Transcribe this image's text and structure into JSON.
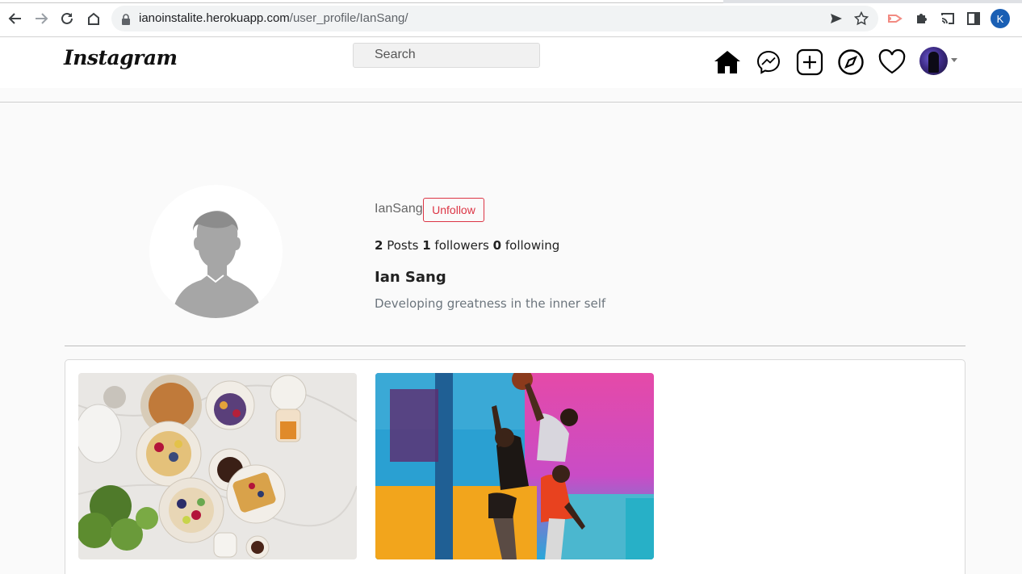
{
  "browser": {
    "url_host": "ianoinstalite.herokuapp.com",
    "url_path": "/user_profile/IanSang/",
    "profile_initial": "K"
  },
  "header": {
    "logo": "Instagram",
    "search_placeholder": "Search",
    "icons": [
      "home-icon",
      "messenger-icon",
      "add-post-icon",
      "explore-icon",
      "heart-icon"
    ]
  },
  "profile": {
    "username": "IanSang",
    "action_label": "Unfollow",
    "posts_count": "2",
    "posts_label": "Posts",
    "followers_count": "1",
    "followers_label": "followers",
    "following_count": "0",
    "following_label": "following",
    "full_name": "Ian Sang",
    "bio": "Developing greatness in the inner self"
  },
  "posts": [
    {
      "subject": "breakfast-flatlay"
    },
    {
      "subject": "basketball-players"
    }
  ],
  "colors": {
    "unfollow": "#dc3545",
    "browser_profile": "#1a5fb4"
  }
}
